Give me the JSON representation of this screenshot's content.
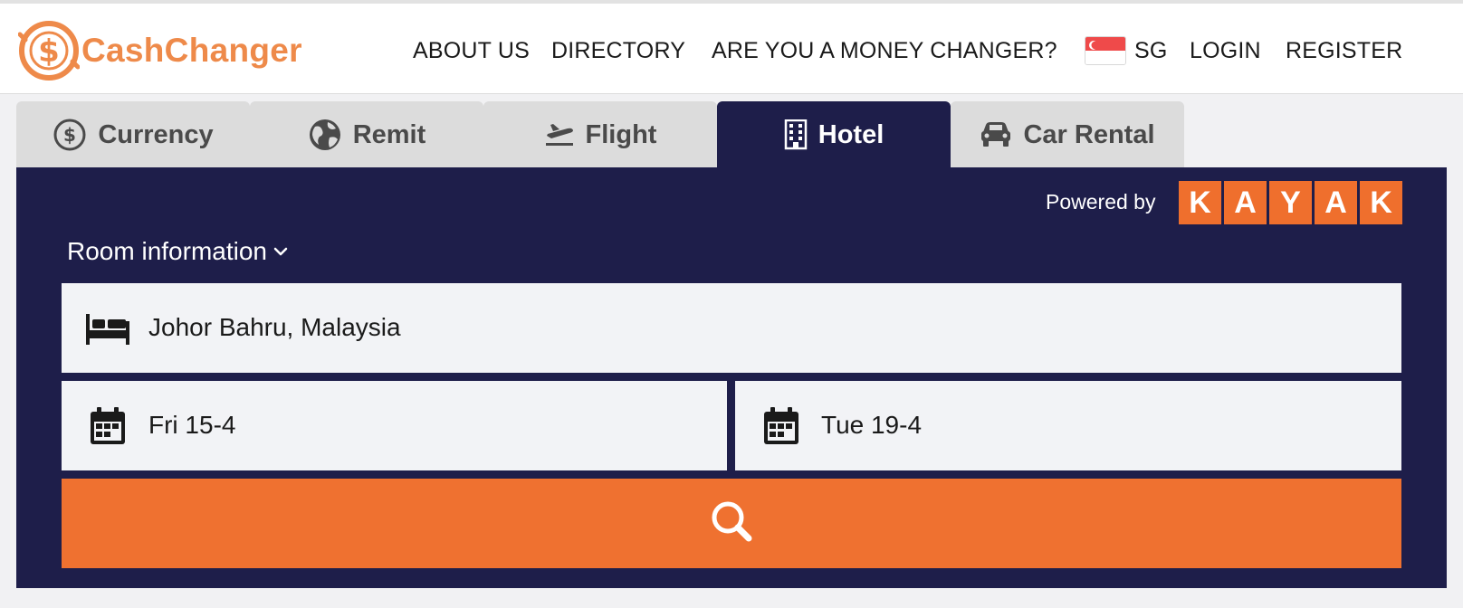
{
  "header": {
    "logo_text": "CashChanger",
    "nav": {
      "about": "ABOUT US",
      "directory": "DIRECTORY",
      "money_changer": "ARE YOU A MONEY CHANGER?",
      "country": "SG",
      "login": "LOGIN",
      "register": "REGISTER"
    }
  },
  "tabs": [
    {
      "label": "Currency",
      "icon": "dollar-coin-icon"
    },
    {
      "label": "Remit",
      "icon": "globe-icon"
    },
    {
      "label": "Flight",
      "icon": "plane-departure-icon"
    },
    {
      "label": "Hotel",
      "icon": "building-icon",
      "active": true
    },
    {
      "label": "Car Rental",
      "icon": "car-icon"
    }
  ],
  "panel": {
    "powered_by": "Powered by",
    "kayak_letters": [
      "K",
      "A",
      "Y",
      "A",
      "K"
    ],
    "room_info": "Room information",
    "destination": "Johor Bahru, Malaysia",
    "checkin": "Fri 15-4",
    "checkout": "Tue 19-4"
  },
  "colors": {
    "brand_orange": "#ef7130",
    "panel_navy": "#1e1e4a",
    "logo_orange": "#ee8a4a"
  }
}
